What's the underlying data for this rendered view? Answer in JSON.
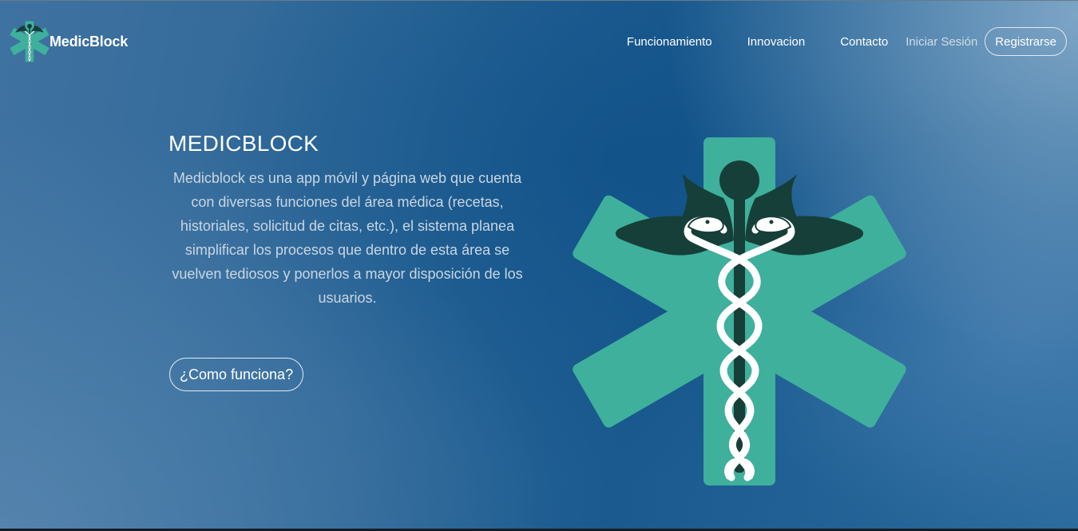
{
  "header": {
    "brand": "MedicBlock",
    "logo_icon": "star-of-life-caduceus-icon",
    "nav": {
      "funcionamiento": "Funcionamiento",
      "innovacion": "Innovacion",
      "contacto": "Contacto",
      "login": "Iniciar Sesión",
      "register": "Registrarse"
    }
  },
  "hero": {
    "title": "MEDICBLOCK",
    "description": "Medicblock es una app móvil y página web que cuenta con diversas funciones del área médica (recetas, historiales, solicitud de citas, etc.), el sistema planea simplificar los procesos que dentro de esta área se vuelven tediosos y ponerlos a mayor disposición de los usuarios.",
    "cta": "¿Como funciona?",
    "illustration_icon": "star-of-life-caduceus-icon"
  },
  "colors": {
    "accent_teal": "#3eb09c",
    "dark_green": "#163f39",
    "snake_white": "#ffffff",
    "bg_blue": "#1a5a8f"
  }
}
